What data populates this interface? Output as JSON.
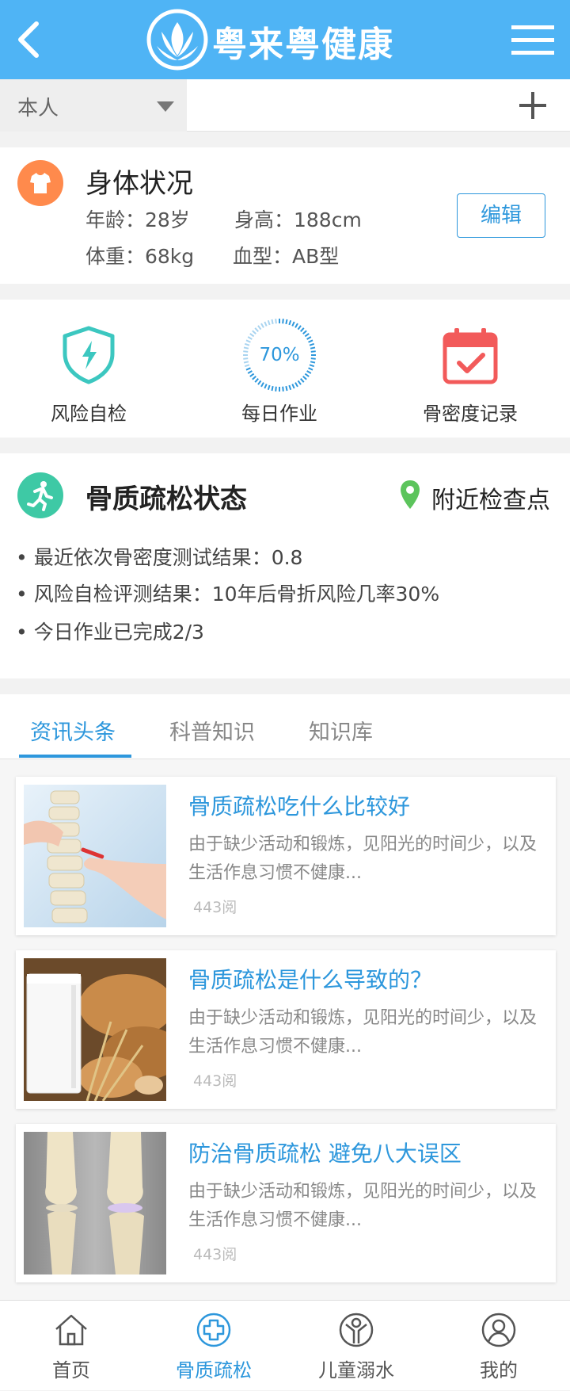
{
  "header": {
    "brand": "粤来粤健康"
  },
  "selector": {
    "value": "本人"
  },
  "body_status": {
    "title": "身体状况",
    "age": "年龄：28岁",
    "height": "身高：188cm",
    "weight": "体重：68kg",
    "blood": "血型：AB型",
    "edit_label": "编辑"
  },
  "features": {
    "risk_label": "风险自检",
    "daily_label": "每日作业",
    "daily_progress": "70%",
    "daily_fraction": 0.7,
    "bmd_label": "骨密度记录"
  },
  "osteo": {
    "title": "骨质疏松状态",
    "nearby": "附近检查点",
    "bullets": [
      "• 最近依次骨密度测试结果：0.8",
      "• 风险自检评测结果：10年后骨折风险几率30%",
      "• 今日作业已完成2/3"
    ]
  },
  "tabs": [
    "资讯头条",
    "科普知识",
    "知识库"
  ],
  "articles": [
    {
      "title": "骨质疏松吃什么比较好",
      "desc": "由于缺少活动和锻炼，见阳光的时间少，以及生活作息习惯不健康...",
      "reads": "443阅"
    },
    {
      "title": "骨质疏松是什么导致的？",
      "desc": "由于缺少活动和锻炼，见阳光的时间少，以及生活作息习惯不健康...",
      "reads": "443阅"
    },
    {
      "title": "防治骨质疏松 避免八大误区",
      "desc": "由于缺少活动和锻炼，见阳光的时间少，以及生活作息习惯不健康...",
      "reads": "443阅"
    }
  ],
  "nav": [
    "首页",
    "骨质疏松",
    "儿童溺水",
    "我的"
  ],
  "colors": {
    "header": "#4fb4f5",
    "accent": "#2d97dc",
    "orange": "#ff8a4c",
    "green": "#3ec9a5",
    "red": "#f25a5a",
    "teal": "#3cc7c0"
  }
}
